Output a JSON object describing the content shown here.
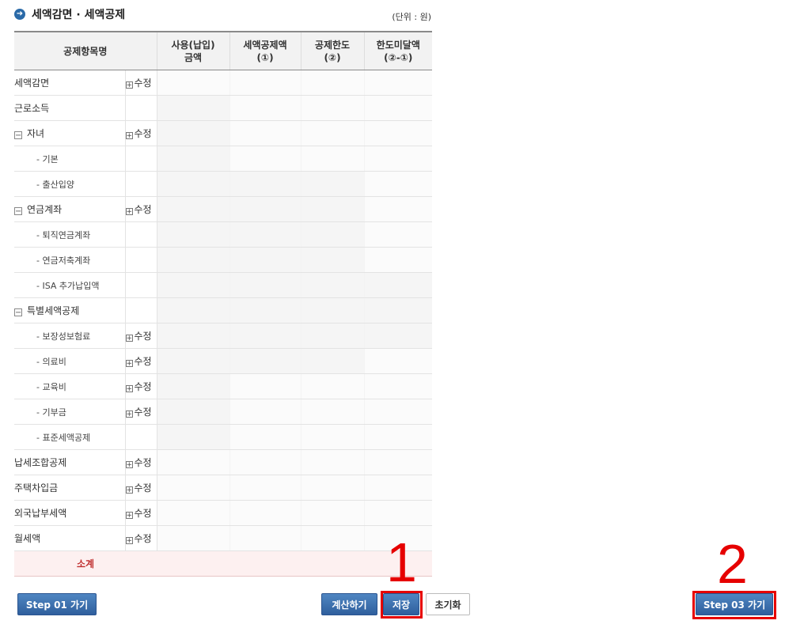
{
  "header": {
    "title": "세액감면 · 세액공제",
    "unit": "(단위 : 원)"
  },
  "table": {
    "columns": {
      "name": "공제항목명",
      "used": [
        "사용(납입)",
        "금액"
      ],
      "credit": [
        "세액공제액",
        "(①)"
      ],
      "limit": [
        "공제한도",
        "(②)"
      ],
      "excess": [
        "한도미달액",
        "(②-①)"
      ]
    },
    "edit_label": "수정",
    "rows": [
      {
        "label": "세액감면"
      },
      {
        "label": "근로소득"
      },
      {
        "label": "자녀"
      },
      {
        "label": "- 기본"
      },
      {
        "label": "- 출산입양"
      },
      {
        "label": "연금계좌"
      },
      {
        "label": "- 퇴직연금계좌"
      },
      {
        "label": "- 연금저축계좌"
      },
      {
        "label": "- ISA 추가납입액"
      },
      {
        "label": "특별세액공제"
      },
      {
        "label": "- 보장성보험료"
      },
      {
        "label": "- 의료비"
      },
      {
        "label": "- 교육비"
      },
      {
        "label": "- 기부금"
      },
      {
        "label": "- 표준세액공제"
      },
      {
        "label": "납세조합공제"
      },
      {
        "label": "주택차입금"
      },
      {
        "label": "외국납부세액"
      },
      {
        "label": "월세액"
      }
    ],
    "subtotal": "소계"
  },
  "buttons": {
    "step01": "Step 01 가기",
    "calculate": "계산하기",
    "save": "저장",
    "reset": "초기화",
    "step03": "Step 03 가기"
  },
  "annotations": {
    "marker1": "1",
    "marker2": "2"
  },
  "colors": {
    "accent": "#2f5f9d",
    "highlight": "#e60000"
  }
}
